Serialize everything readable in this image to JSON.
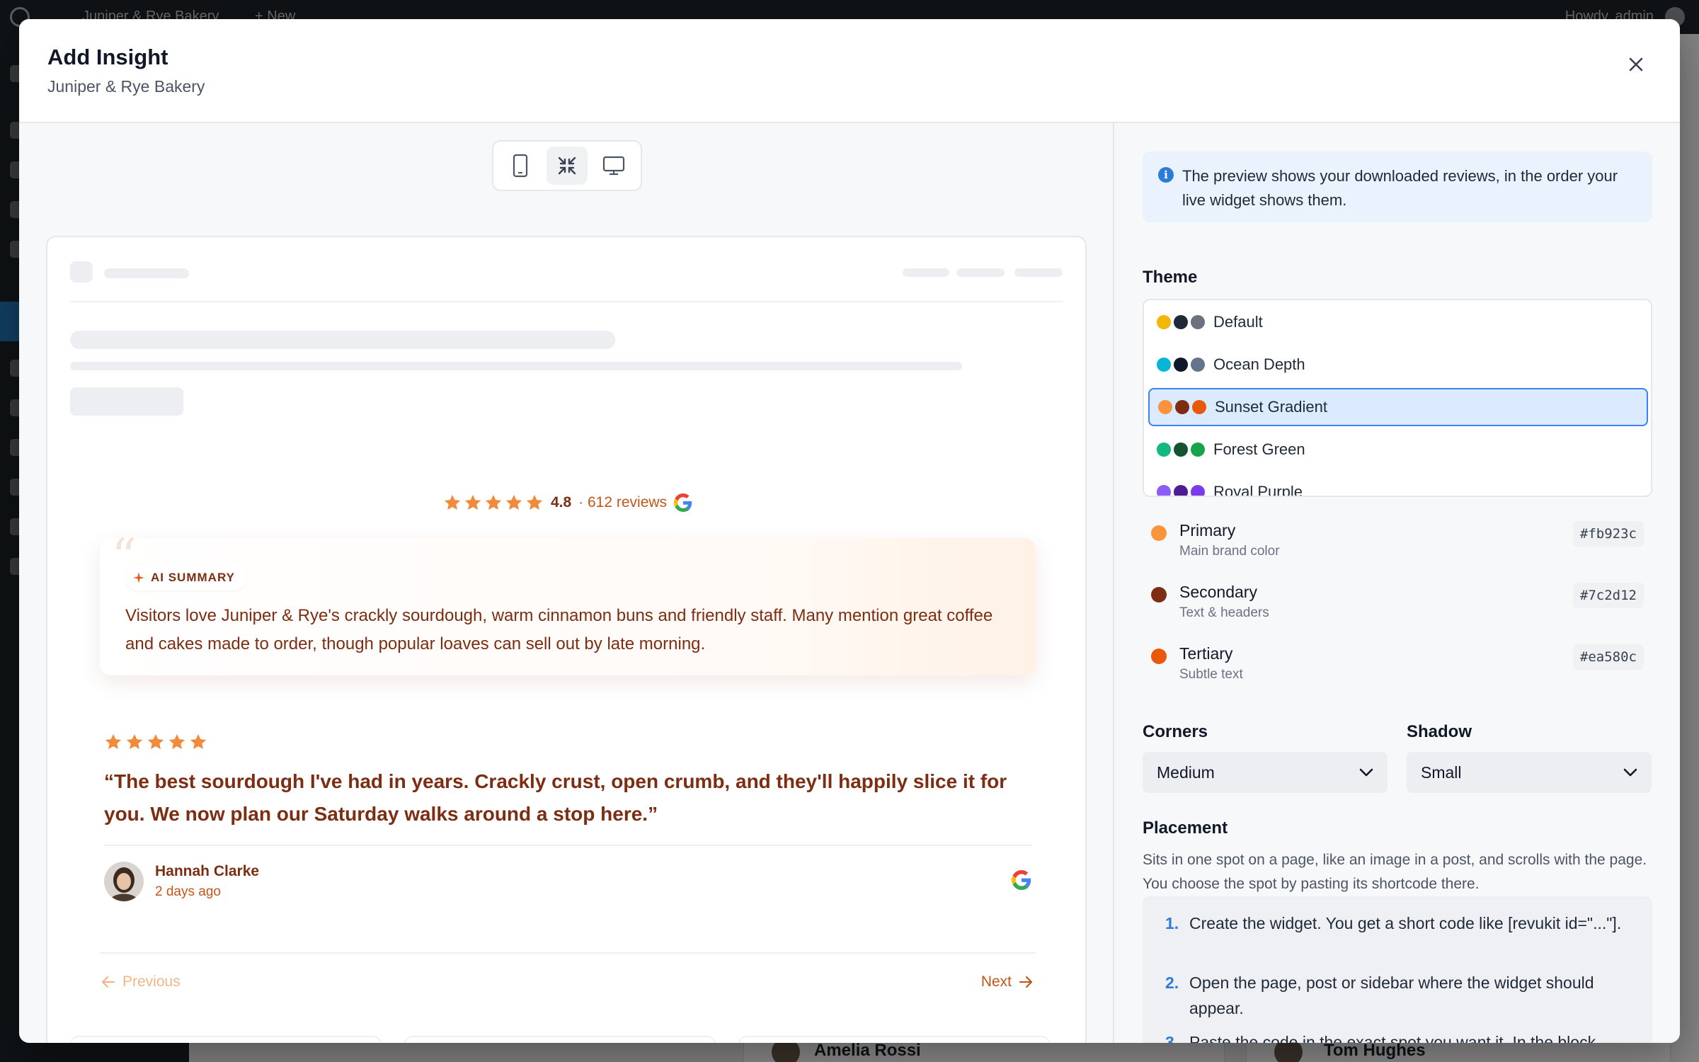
{
  "wp": {
    "site_name": "Juniper & Rye Bakery",
    "new_label": "New",
    "howdy": "Howdy, admin",
    "bg_names": [
      "Amelia Rossi",
      "Tom Hughes"
    ]
  },
  "modal": {
    "title": "Add Insight",
    "subtitle": "Juniper & Rye Bakery"
  },
  "device_toggle": {
    "options": [
      "mobile-icon",
      "compact-icon",
      "desktop-icon"
    ],
    "active": "compact-icon"
  },
  "preview": {
    "rating_value": "4.8",
    "rating_count": "· 612 reviews",
    "stars": 5,
    "ai_summary": {
      "badge": "AI SUMMARY",
      "text": "Visitors love Juniper & Rye's crackly sourdough, warm cinnamon buns and friendly staff. Many mention great coffee and cakes made to order, though popular loaves can sell out by late morning."
    },
    "review": {
      "stars": 5,
      "quote": "“The best sourdough I've had in years. Crackly crust, open crumb, and they'll happily slice it for you. We now plan our Saturday walks around a stop here.”",
      "author": "Hannah Clarke",
      "date": "2 days ago",
      "source_icon": "google-icon"
    },
    "pager": {
      "prev": "Previous",
      "next": "Next"
    }
  },
  "settings": {
    "info_text": "The preview shows your downloaded reviews, in the order your live widget shows them.",
    "theme_label": "Theme",
    "themes": [
      {
        "name": "Default",
        "colors": [
          "#f2b705",
          "#1f2937",
          "#6b7280"
        ]
      },
      {
        "name": "Ocean Depth",
        "colors": [
          "#06b6d4",
          "#0f172a",
          "#64748b"
        ]
      },
      {
        "name": "Sunset Gradient",
        "colors": [
          "#fb923c",
          "#7c2d12",
          "#ea580c"
        ],
        "selected": true
      },
      {
        "name": "Forest Green",
        "colors": [
          "#10b981",
          "#14532d",
          "#16a34a"
        ]
      },
      {
        "name": "Royal Purple",
        "colors": [
          "#8b5cf6",
          "#4c1d95",
          "#7c3aed"
        ]
      }
    ],
    "colors": [
      {
        "name": "Primary",
        "desc": "Main brand color",
        "hex": "#fb923c"
      },
      {
        "name": "Secondary",
        "desc": "Text & headers",
        "hex": "#7c2d12"
      },
      {
        "name": "Tertiary",
        "desc": "Subtle text",
        "hex": "#ea580c"
      }
    ],
    "corners": {
      "label": "Corners",
      "value": "Medium"
    },
    "shadow": {
      "label": "Shadow",
      "value": "Small"
    },
    "placement": {
      "label": "Placement",
      "desc": "Sits in one spot on a page, like an image in a post, and scrolls with the page. You choose the spot by pasting its shortcode there.",
      "steps": [
        {
          "num": "1.",
          "text": "Create the widget. You get a short code like [revukit id=\"...\"]."
        },
        {
          "num": "2.",
          "text": "Open the page, post or sidebar where the widget should appear."
        },
        {
          "num": "3.",
          "text": "Paste the code in the exact spot you want it. In the block"
        }
      ]
    }
  }
}
